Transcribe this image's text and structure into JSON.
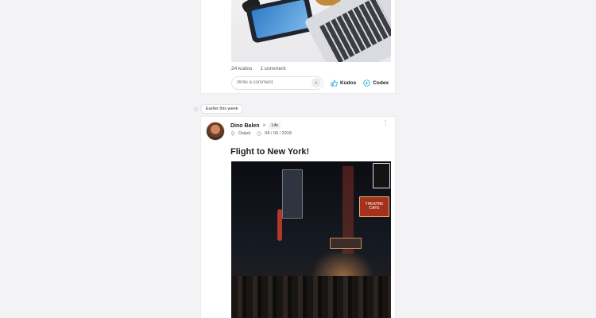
{
  "top_post": {
    "kudos_count": "24 kudos",
    "comment_count": "1 comment",
    "comment_placeholder": "Write a comment",
    "kudos_label": "Kudos",
    "codex_label": "Codex"
  },
  "timeline": {
    "label": "Earlier this week"
  },
  "post": {
    "author": "Dino Balen",
    "in_word": "in",
    "category": "Life",
    "location": "Osijek",
    "date": "08 / 06 / 2018",
    "title": "Flight to New York!",
    "image_signs": [
      "THEATRE CAFE"
    ]
  },
  "colors": {
    "accent": "#2aa8d8",
    "background": "#f3f3f5",
    "card": "#ffffff"
  },
  "icons": {
    "kudos": "thumbs-up-icon",
    "codex": "plus-circle-icon",
    "location": "map-pin-icon",
    "date": "clock-icon",
    "more": "vertical-dots-icon",
    "send": "send-icon"
  }
}
